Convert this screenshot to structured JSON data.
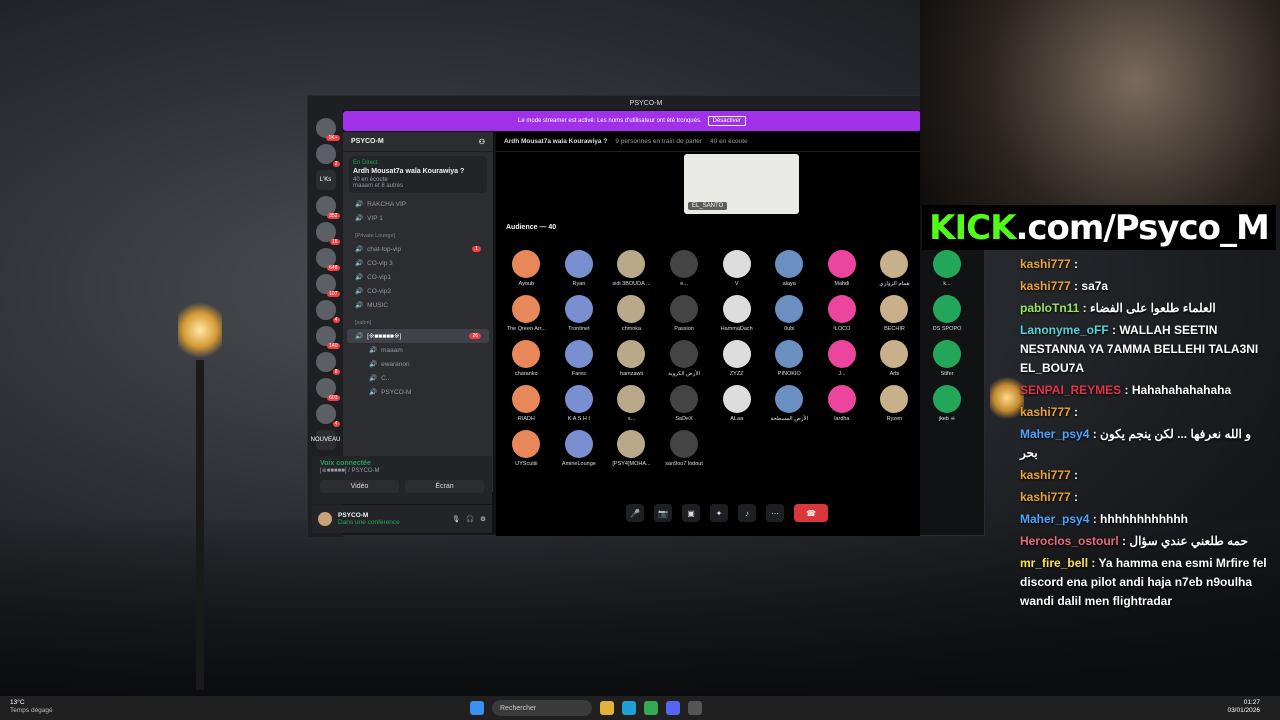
{
  "window": {
    "title": "PSYCO-M"
  },
  "banner": {
    "text": "Le mode streamer est activé. Les noms d'utilisateur ont été tronqués.",
    "button": "Désactiver"
  },
  "servers": [
    {
      "badge": "1K+"
    },
    {
      "badge": "2"
    },
    {
      "label": "L'Ks"
    },
    {
      "badge": "352"
    },
    {
      "badge": "16"
    },
    {
      "badge": "648"
    },
    {
      "badge": "107"
    },
    {
      "badge": "4"
    },
    {
      "badge": "140"
    },
    {
      "badge": "8"
    },
    {
      "badge": "603"
    },
    {
      "badge": "4"
    },
    {
      "label": "NOUVEAU"
    }
  ],
  "sidebar": {
    "server_name": "PSYCO-M",
    "live": {
      "tag": "En Direct",
      "title": "Ardh Mousat7a wala Kourawiya ?",
      "listeners": "40 en écoute",
      "others": "maaam et 8 autres"
    },
    "channels": [
      {
        "name": "RAKCHA VIP"
      },
      {
        "name": "VIP 1"
      },
      {
        "name": "[Private Lounge]",
        "category": true
      },
      {
        "name": "chat-top-vip",
        "badge": "1"
      },
      {
        "name": "CO-vip 3"
      },
      {
        "name": "CO-vip1"
      },
      {
        "name": "CO-vip2"
      },
      {
        "name": "MUSIC"
      },
      {
        "name": "[salon]",
        "category": true
      },
      {
        "name": "[※■■■■■※]",
        "badge": "26",
        "sub": "Ardh Mousat7a wala Kourawiya ?"
      },
      {
        "name": "maaam"
      },
      {
        "name": "ewaranon"
      },
      {
        "name": "C..."
      },
      {
        "name": "PSYCO-M"
      }
    ],
    "voice": {
      "status": "Voix connectée",
      "channel": "[※■■■■■] / PSYCO-M",
      "video_btn": "Vidéo",
      "screen_btn": "Écran"
    },
    "user": {
      "name": "PSYCO-M",
      "status": "Dans une conférence"
    }
  },
  "stage": {
    "title": "Ardh Mousat7a wala Kourawiya ?",
    "speaking": "9 personnes en train de parler",
    "listening": "40 en écoute",
    "speaker_name": "EL_SANTO",
    "audience_header": "Audience — 40",
    "audience": [
      "Ayoub",
      "Ryan",
      "sidi 3BOUDA ...",
      "e...",
      "V",
      "alaya",
      "Mahdi",
      "همام الزواري",
      "k...",
      "The Qreen Arr...",
      "Trontinet",
      "chmnka",
      "Passion",
      "HammaDach",
      "0ubi",
      "!LOCO",
      "BECHIR",
      "DS SPOPO",
      "charanko",
      "Fares",
      "hamzawii",
      "الأرض الكروية",
      "ZYZZ",
      "PINOKIO",
      "J...",
      "Arbi",
      "Stifer",
      "RIADH",
      "K A S H I",
      "s...",
      "SaDeX",
      "ALaa",
      "الأرض المسطحة",
      "lardha",
      "Ryzen",
      "jkeb ☠",
      "UYScutiii",
      "AmineLounge",
      "[PSY4]MOHA...",
      "san9ou7 lodout"
    ]
  },
  "stream": {
    "overlay_text": "KICK.com/Psyco_M",
    "brand_color": "#53fc18"
  },
  "chat": [
    {
      "user": "kashi777",
      "color": "#e8a33a",
      "text": ""
    },
    {
      "user": "kashi777",
      "color": "#e8a33a",
      "text": "sa7a"
    },
    {
      "user": "pabloTn11",
      "color": "#9be35c",
      "text": "العلماء طلعوا على الفضاء"
    },
    {
      "user": "Lanonyme_oFF",
      "color": "#5ad1d6",
      "text": "WALLAH SEETIN NESTANNA YA 7AMMA BELLEHI TALA3NI EL_BOU7A"
    },
    {
      "user": "SENPAI_REYMES",
      "color": "#e0344d",
      "text": "Hahahahahahaha"
    },
    {
      "user": "kashi777",
      "color": "#e8a33a",
      "text": ""
    },
    {
      "user": "Maher_psy4",
      "color": "#4ea3ff",
      "text": "و الله نعرفها ... لكن ينجم يكون بحر"
    },
    {
      "user": "kashi777",
      "color": "#e8a33a",
      "text": ""
    },
    {
      "user": "kashi777",
      "color": "#e8a33a",
      "text": ""
    },
    {
      "user": "Maher_psy4",
      "color": "#4ea3ff",
      "text": "hhhhhhhhhhhh"
    },
    {
      "user": "Heroclos_ostourl",
      "color": "#e86a7a",
      "text": "حمه طلعني عندي سؤال"
    },
    {
      "user": "mr_fire_bell",
      "color": "#ffe14f",
      "text": "Ya hamma ena esmi Mrfire fel discord ena pilot andi haja n7eb n9oulha wandi dalil men flightradar"
    }
  ],
  "taskbar": {
    "temp": "13°C",
    "weather": "Temps dégagé",
    "search": "Rechercher",
    "time": "01:27",
    "date": "03/01/2026"
  }
}
